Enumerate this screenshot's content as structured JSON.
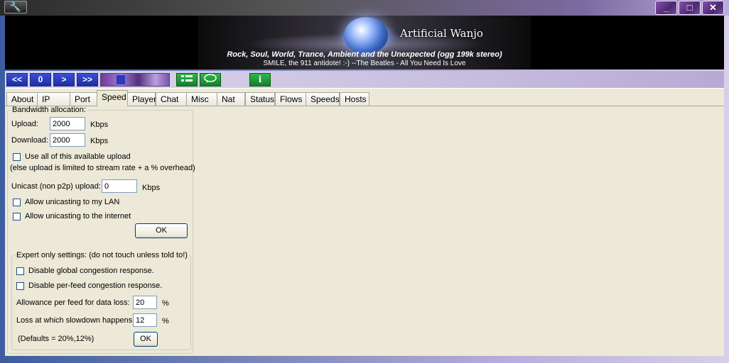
{
  "titlebar": {
    "menu_icon": "wrench-icon",
    "minimize_label": "_",
    "maximize_label": "□",
    "close_label": "✕"
  },
  "banner": {
    "brand": "Artificial Wanjo",
    "tagline": "Rock, Soul, World, Trance, Ambient and the  Unexpected  (ogg 199k stereo)",
    "now_playing": "SMILE, the 911 antidote! :-) --The Beatles - All You Need Is Love"
  },
  "toolbar": {
    "prev_label": "<<",
    "zero_label": "0",
    "next_label": ">",
    "end_label": ">>",
    "info_label": "i"
  },
  "tabs": [
    "About",
    "IP",
    "Port",
    "Speed",
    "Player",
    "Chat",
    "Misc",
    "Nat",
    "Status",
    "Flows",
    "Speeds",
    "Hosts"
  ],
  "active_tab": "Speed",
  "bandwidth": {
    "legend": "Bandwidth allocation:",
    "upload_label": "Upload:",
    "upload_value": "2000",
    "upload_unit": "Kbps",
    "download_label": "Download:",
    "download_value": "2000",
    "download_unit": "Kbps",
    "use_all_label": "Use all of this available upload",
    "use_all_note": "(else upload is limited to stream rate + a % overhead)",
    "unicast_label": "Unicast (non p2p) upload:",
    "unicast_value": "0",
    "unicast_unit": "Kbps",
    "allow_lan_label": "Allow unicasting to my LAN",
    "allow_internet_label": "Allow unicasting to the internet",
    "ok_label": "OK"
  },
  "expert": {
    "legend": "Expert only settings: (do not touch unless told to!)",
    "disable_global_label": "Disable global congestion response.",
    "disable_perfeed_label": "Disable per-feed congestion response.",
    "allowance_label": "Allowance per feed for data loss:",
    "allowance_value": "20",
    "allowance_unit": "%",
    "loss_label": "Loss at which slowdown happens:",
    "loss_value": "12",
    "loss_unit": "%",
    "defaults_note": "(Defaults = 20%,12%)",
    "ok_label": "OK"
  }
}
